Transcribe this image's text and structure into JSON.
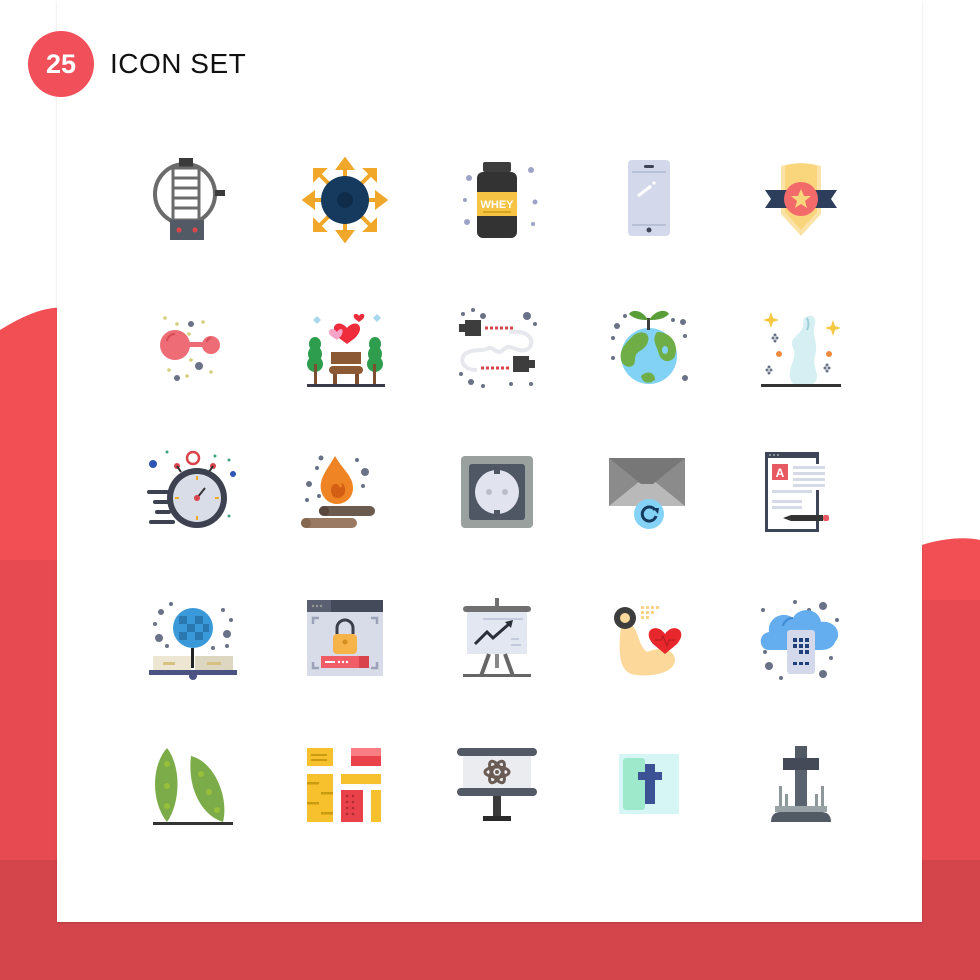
{
  "header": {
    "badge_number": "25",
    "title": "ICON SET"
  },
  "colors": {
    "accent": "#f1505a",
    "background_band": "#d4444b",
    "card": "#ffffff"
  },
  "icons": [
    {
      "name": "blender-icon"
    },
    {
      "name": "virus-spread-icon"
    },
    {
      "name": "whey-protein-icon",
      "label": "WHEY"
    },
    {
      "name": "smartphone-icon"
    },
    {
      "name": "shield-star-badge-icon"
    },
    {
      "name": "molecule-icon"
    },
    {
      "name": "park-bench-love-icon"
    },
    {
      "name": "cable-connector-icon"
    },
    {
      "name": "eco-earth-sprout-icon"
    },
    {
      "name": "magic-smoke-icon"
    },
    {
      "name": "stopwatch-speed-icon"
    },
    {
      "name": "campfire-icon"
    },
    {
      "name": "power-socket-icon"
    },
    {
      "name": "email-refresh-icon"
    },
    {
      "name": "document-editor-icon",
      "label": "A"
    },
    {
      "name": "global-education-icon"
    },
    {
      "name": "secure-login-icon"
    },
    {
      "name": "presentation-chart-icon"
    },
    {
      "name": "fitness-heart-icon"
    },
    {
      "name": "cloud-mobile-icon"
    },
    {
      "name": "leaves-icon"
    },
    {
      "name": "layout-blocks-icon"
    },
    {
      "name": "science-presentation-icon"
    },
    {
      "name": "bible-cross-icon"
    },
    {
      "name": "grave-cross-icon"
    }
  ]
}
